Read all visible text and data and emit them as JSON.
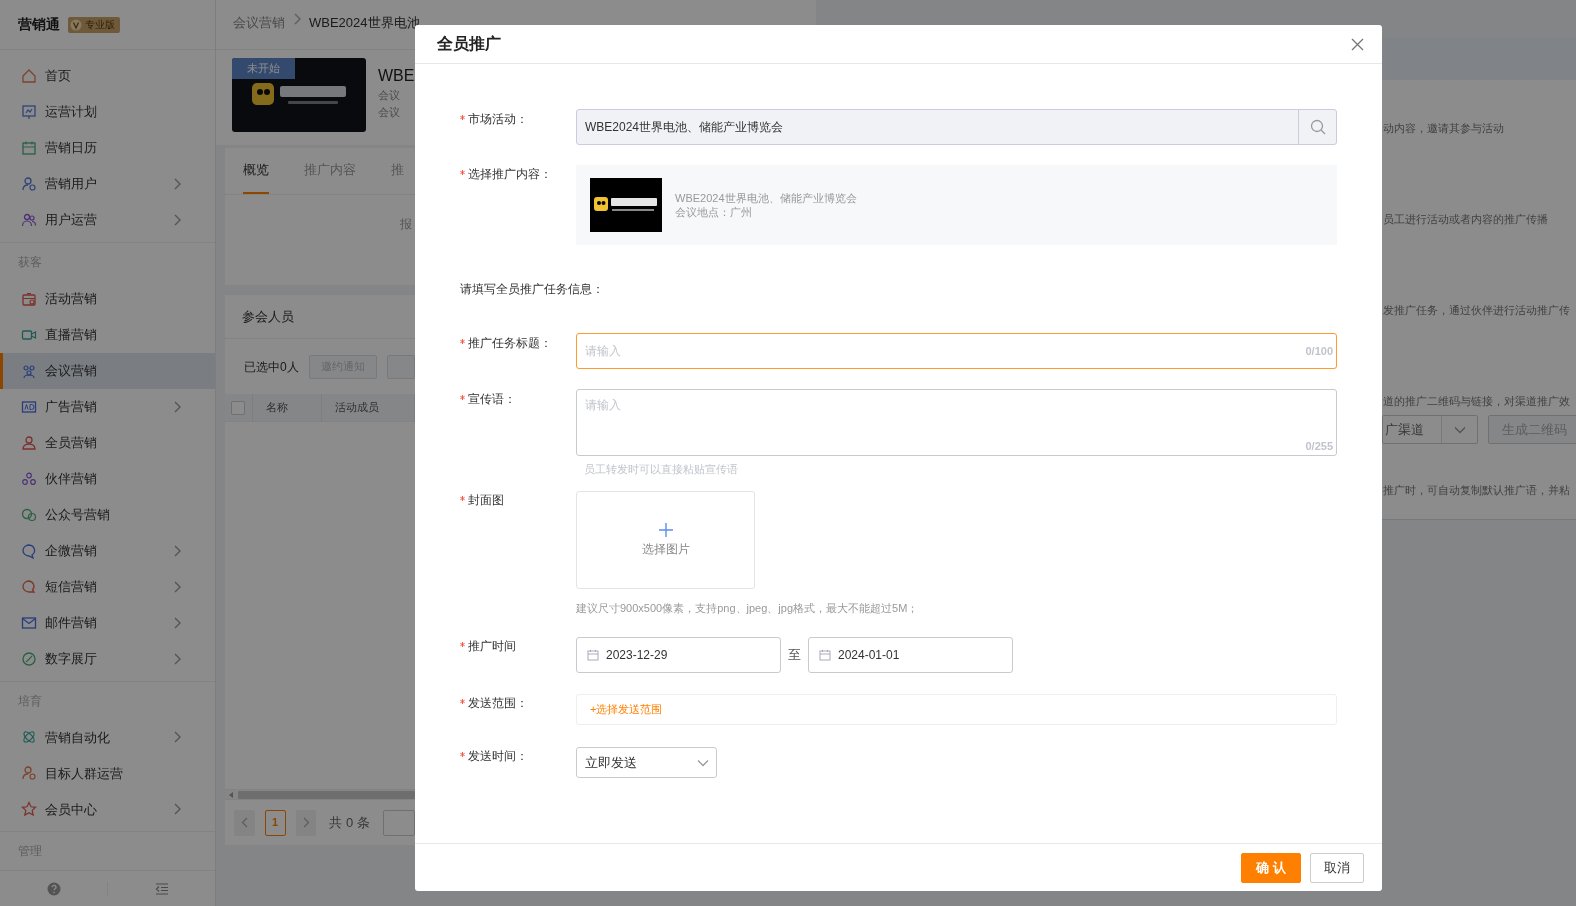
{
  "sidebar": {
    "app_name": "营销通",
    "edition_badge": "专业版",
    "sections": [
      {
        "items": [
          {
            "label": "首页",
            "selected": false,
            "has_submenu": false
          },
          {
            "label": "运营计划",
            "selected": false,
            "has_submenu": false
          },
          {
            "label": "营销日历",
            "selected": false,
            "has_submenu": false
          },
          {
            "label": "营销用户",
            "selected": false,
            "has_submenu": true
          },
          {
            "label": "用户运营",
            "selected": false,
            "has_submenu": true
          }
        ]
      },
      {
        "heading": "获客",
        "items": [
          {
            "label": "活动营销",
            "selected": false,
            "has_submenu": false
          },
          {
            "label": "直播营销",
            "selected": false,
            "has_submenu": false
          },
          {
            "label": "会议营销",
            "selected": true,
            "has_submenu": false
          },
          {
            "label": "广告营销",
            "selected": false,
            "has_submenu": true
          },
          {
            "label": "全员营销",
            "selected": false,
            "has_submenu": false
          },
          {
            "label": "伙伴营销",
            "selected": false,
            "has_submenu": false
          },
          {
            "label": "公众号营销",
            "selected": false,
            "has_submenu": false
          },
          {
            "label": "企微营销",
            "selected": false,
            "has_submenu": true
          },
          {
            "label": "短信营销",
            "selected": false,
            "has_submenu": true
          },
          {
            "label": "邮件营销",
            "selected": false,
            "has_submenu": true
          },
          {
            "label": "数字展厅",
            "selected": false,
            "has_submenu": true
          }
        ]
      },
      {
        "heading": "培育",
        "items": [
          {
            "label": "营销自动化",
            "selected": false,
            "has_submenu": true
          },
          {
            "label": "目标人群运营",
            "selected": false,
            "has_submenu": false
          },
          {
            "label": "会员中心",
            "selected": false,
            "has_submenu": true
          }
        ]
      },
      {
        "heading": "管理"
      }
    ]
  },
  "breadcrumb": [
    "会议营销",
    "WBE2024世界电池"
  ],
  "event": {
    "status": "未开始",
    "title": "WBE",
    "lines": [
      "会议",
      "会议"
    ]
  },
  "tabs": [
    {
      "label": "概览",
      "selected": true
    },
    {
      "label": "推广内容",
      "selected": false
    },
    {
      "label": "推",
      "selected": false
    }
  ],
  "overview_text": "报",
  "attendees": {
    "title": "参会人员",
    "selected_count": "已选中0人",
    "buttons": [
      {
        "label": "邀约通知",
        "disabled": true
      }
    ],
    "columns": [
      {
        "kind": "checkbox",
        "checked": false
      },
      {
        "kind": "text",
        "label": "名称"
      },
      {
        "kind": "text",
        "label": "活动成员"
      }
    ],
    "pagination": {
      "pages": [
        {
          "label": "1",
          "selected": true
        }
      ],
      "total": "共 0 条"
    }
  },
  "side_panel": {
    "items": [
      {
        "kind": "text",
        "text": "动内容，邀请其参与活动"
      },
      {
        "kind": "text",
        "text": "员工进行活动或者内容的推广传播"
      },
      {
        "kind": "text",
        "text": "发推广任务，通过伙伴进行活动推广传"
      },
      {
        "kind": "text",
        "text": "道的推广二维码与链接，对渠道推广效"
      },
      {
        "kind": "controls",
        "select": "广渠道",
        "button": "生成二维码"
      },
      {
        "kind": "text",
        "text": "推广时，可自动复制默认推广语，并粘"
      }
    ]
  },
  "dialog": {
    "title": "全员推广",
    "fields": [
      {
        "kind": "search",
        "label": "市场活动：",
        "required": true,
        "value": "WBE2024世界电池、储能产业博览会"
      },
      {
        "kind": "content_card",
        "label": "选择推广内容：",
        "required": true,
        "title": "WBE2024世界电池、储能产业博览会",
        "subtitle": "会议地点：广州"
      },
      {
        "kind": "section_note",
        "text": "请填写全员推广任务信息："
      },
      {
        "kind": "input",
        "label": "推广任务标题：",
        "required": true,
        "placeholder": "请输入",
        "counter": "0/100",
        "focused": true
      },
      {
        "kind": "textarea",
        "label": "宣传语：",
        "required": true,
        "placeholder": "请输入",
        "counter": "0/255",
        "focused": false,
        "hint": "员工转发时可以直接粘贴宣传语"
      },
      {
        "kind": "upload",
        "label": "封面图",
        "required": true,
        "button": "选择图片",
        "hint": "建议尺寸900x500像素，支持png、jpeg、jpg格式，最大不能超过5M；"
      },
      {
        "kind": "date_range",
        "label": "推广时间",
        "required": true,
        "start": "2023-12-29",
        "separator": "至",
        "end": "2024-01-01"
      },
      {
        "kind": "link",
        "label": "发送范围：",
        "required": true,
        "link": "+选择发送范围"
      },
      {
        "kind": "select",
        "label": "发送时间：",
        "required": true,
        "value": "立即发送"
      }
    ],
    "buttons": [
      {
        "kind": "primary",
        "label": "确 认"
      },
      {
        "kind": "default",
        "label": "取消"
      }
    ]
  }
}
